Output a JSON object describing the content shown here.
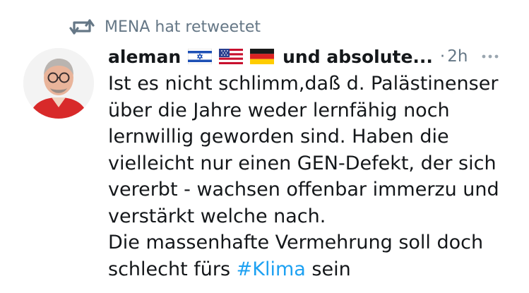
{
  "retweet": {
    "icon": "retweet-icon",
    "label": "MENA hat retweetet"
  },
  "tweet": {
    "avatar": "avatar",
    "author_name": "aleman",
    "flags": [
      "israel-flag",
      "usa-flag",
      "germany-flag"
    ],
    "author_rest": "und absolute...",
    "separator": "·",
    "timestamp": "2h",
    "more_icon": "more-icon",
    "text_lines": {
      "l1": "Ist es nicht schlimm,daß d. Palästinenser",
      "l2": "über die Jahre weder lernfähig noch",
      "l3": "lernwillig geworden sind. Haben die",
      "l4": "vielleicht nur einen GEN-Defekt, der sich",
      "l5": "vererbt - wachsen offenbar immerzu und",
      "l6": "verstärkt welche nach.",
      "l7": "Die massenhafte Vermehrung soll doch",
      "l8_pre": "schlecht fürs ",
      "l8_hashtag": "#Klima",
      "l8_post": " sein"
    }
  },
  "colors": {
    "secondary_text": "#657786",
    "primary_text": "#14171a",
    "hashtag": "#1da1f2"
  }
}
